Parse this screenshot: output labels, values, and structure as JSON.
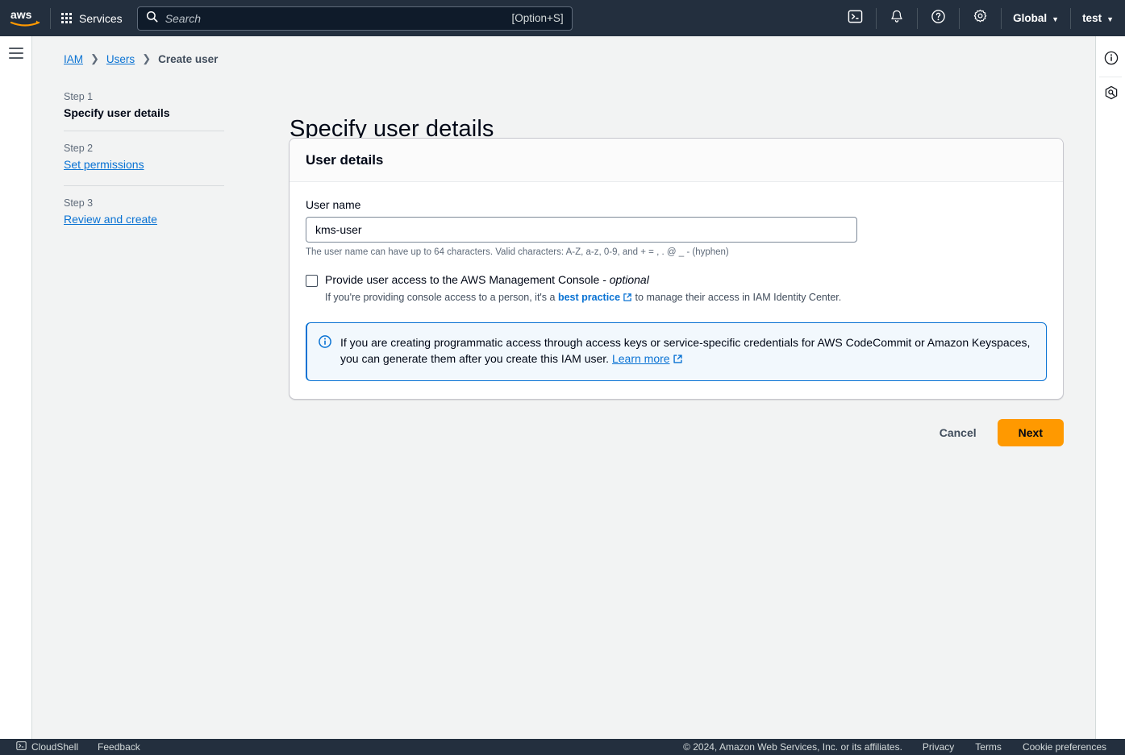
{
  "topnav": {
    "logo_alt": "aws",
    "services_label": "Services",
    "search": {
      "placeholder": "Search",
      "value": "",
      "shortcut": "[Option+S]"
    },
    "cloudshell_icon": "cloudshell-icon",
    "notifications_icon": "bell-icon",
    "help_icon": "question-circle-icon",
    "settings_icon": "gear-icon",
    "region_label": "Global",
    "account_label": "test"
  },
  "breadcrumb": {
    "items": [
      {
        "label": "IAM",
        "link": true
      },
      {
        "label": "Users",
        "link": true
      },
      {
        "label": "Create user",
        "link": false
      }
    ],
    "separator": "❯"
  },
  "steps": [
    {
      "step": "Step 1",
      "title": "Specify user details",
      "active": true
    },
    {
      "step": "Step 2",
      "title": "Set permissions",
      "active": false
    },
    {
      "step": "Step 3",
      "title": "Review and create",
      "active": false
    }
  ],
  "page": {
    "title": "Specify user details"
  },
  "card": {
    "header": "User details",
    "user_name": {
      "label": "User name",
      "value": "kms-user",
      "placeholder": "",
      "hint": "The user name can have up to 64 characters. Valid characters: A-Z, a-z, 0-9, and + = , . @ _ - (hyphen)"
    },
    "console_access": {
      "checked": false,
      "label_main": "Provide user access to the AWS Management Console - ",
      "label_optional": "optional",
      "sub_prefix": "If you're providing console access to a person, it's a ",
      "sub_link": "best practice",
      "sub_suffix": " to manage their access in IAM Identity Center."
    },
    "alert": {
      "icon": "info-circle-icon",
      "text": "If you are creating programmatic access through access keys or service-specific credentials for AWS CodeCommit or Amazon Keyspaces, you can generate them after you create this IAM user. ",
      "link": "Learn more"
    }
  },
  "actions": {
    "cancel_label": "Cancel",
    "next_label": "Next"
  },
  "right_rail": {
    "info_icon": "info-panel-icon",
    "security_icon": "shield-lock-icon"
  },
  "footer": {
    "cloudshell_label": "CloudShell",
    "feedback_label": "Feedback",
    "copyright": "© 2024, Amazon Web Services, Inc. or its affiliates.",
    "privacy_label": "Privacy",
    "terms_label": "Terms",
    "cookie_label": "Cookie preferences"
  },
  "colors": {
    "nav_bg": "#232f3e",
    "accent_orange": "#ff9900",
    "link_blue": "#0972d3",
    "page_bg": "#f2f3f3",
    "alert_bg": "#f2f8fd"
  }
}
